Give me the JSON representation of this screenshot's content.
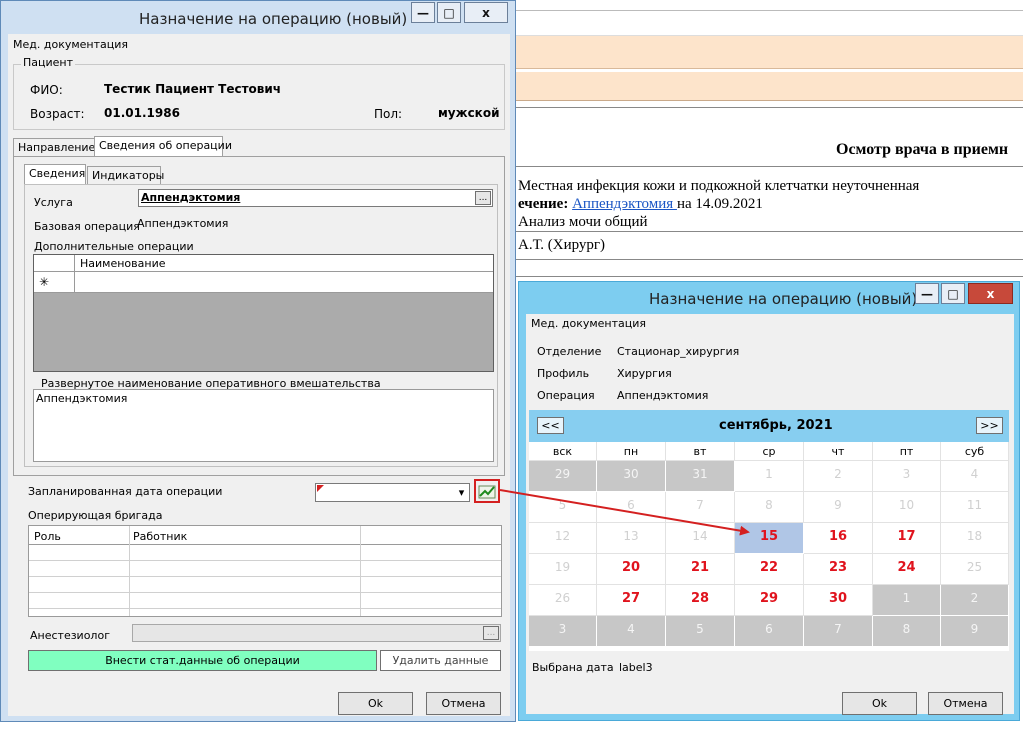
{
  "background_doc": {
    "heading": "Осмотр врача в приемн",
    "line1": "Местная инфекция кожи и подкожной клетчатки неуточненная",
    "line2_label": "ечение: ",
    "line2_link": "Аппендэктомия ",
    "line2_rest": "на 14.09.2021",
    "line3": "Анализ мочи общий",
    "line4": "А.Т. (Хирург)"
  },
  "main_window": {
    "title": "Назначение на операцию (новый)",
    "controls": {
      "minimize": "—",
      "maximize": "□",
      "close": "x"
    },
    "menu_label": "Мед. документация",
    "patient": {
      "group_label": "Пациент",
      "fio_label": "ФИО:",
      "fio_value": "Тестик Пациент Тестович",
      "age_label": "Возраст:",
      "age_value": "01.01.1986",
      "sex_label": "Пол:",
      "sex_value": "мужской"
    },
    "tabs": [
      "Направление",
      "Сведения об операции"
    ],
    "subtabs": [
      "Сведения",
      "Индикаторы"
    ],
    "service_label": "Услуга",
    "service_value": "Аппендэктомия",
    "browse_label": "...",
    "base_op_label": "Базовая операция",
    "base_op_value": "Аппендэктомия",
    "extra_ops_label": "Дополнительные операции",
    "extra_ops_column": "Наименование",
    "new_row_marker": "✳",
    "full_name_label": "Развернутое наименование оперативного вмешательства",
    "full_name_value": "Аппендэктомия",
    "planned_date_label": "Запланированная дата операции",
    "dropdown_arrow": "▾",
    "team_label": "Оперирующая бригада",
    "team_columns": [
      "Роль",
      "Работник"
    ],
    "anesthesiologist_label": "Анестезиолог",
    "stat_button": "Внести стат.данные об операции",
    "delete_button": "Удалить данные",
    "ok_button": "Ok",
    "cancel_button": "Отмена",
    "stat_button_color": "#80ffc0"
  },
  "calendar_window": {
    "title": "Назначение на операцию (новый)",
    "controls": {
      "minimize": "—",
      "maximize": "□",
      "close": "x"
    },
    "menu_label": "Мед. документация",
    "department_label": "Отделение",
    "department_value": "Стационар_хирургия",
    "profile_label": "Профиль",
    "profile_value": "Хирургия",
    "operation_label": "Операция",
    "operation_value": "Аппендэктомия",
    "prev_button": "<<",
    "next_button": ">>",
    "month_title": "сентябрь, 2021",
    "weekdays": [
      "вск",
      "пн",
      "вт",
      "ср",
      "чт",
      "пт",
      "суб"
    ],
    "weeks": [
      [
        {
          "d": "29",
          "s": "other"
        },
        {
          "d": "30",
          "s": "other"
        },
        {
          "d": "31",
          "s": "other"
        },
        {
          "d": "1",
          "s": "past"
        },
        {
          "d": "2",
          "s": "past"
        },
        {
          "d": "3",
          "s": "past"
        },
        {
          "d": "4",
          "s": "past"
        }
      ],
      [
        {
          "d": "5",
          "s": "past"
        },
        {
          "d": "6",
          "s": "past"
        },
        {
          "d": "7",
          "s": "past"
        },
        {
          "d": "8",
          "s": "past"
        },
        {
          "d": "9",
          "s": "past"
        },
        {
          "d": "10",
          "s": "past"
        },
        {
          "d": "11",
          "s": "past"
        }
      ],
      [
        {
          "d": "12",
          "s": "past"
        },
        {
          "d": "13",
          "s": "past"
        },
        {
          "d": "14",
          "s": "past"
        },
        {
          "d": "15",
          "s": "selected"
        },
        {
          "d": "16",
          "s": "active"
        },
        {
          "d": "17",
          "s": "active"
        },
        {
          "d": "18",
          "s": "past"
        }
      ],
      [
        {
          "d": "19",
          "s": "past"
        },
        {
          "d": "20",
          "s": "active"
        },
        {
          "d": "21",
          "s": "active"
        },
        {
          "d": "22",
          "s": "active"
        },
        {
          "d": "23",
          "s": "active"
        },
        {
          "d": "24",
          "s": "active"
        },
        {
          "d": "25",
          "s": "past"
        }
      ],
      [
        {
          "d": "26",
          "s": "past"
        },
        {
          "d": "27",
          "s": "active"
        },
        {
          "d": "28",
          "s": "active"
        },
        {
          "d": "29",
          "s": "active"
        },
        {
          "d": "30",
          "s": "active"
        },
        {
          "d": "1",
          "s": "other"
        },
        {
          "d": "2",
          "s": "other"
        }
      ],
      [
        {
          "d": "3",
          "s": "other"
        },
        {
          "d": "4",
          "s": "other"
        },
        {
          "d": "5",
          "s": "other"
        },
        {
          "d": "6",
          "s": "other"
        },
        {
          "d": "7",
          "s": "other"
        },
        {
          "d": "8",
          "s": "other"
        },
        {
          "d": "9",
          "s": "other"
        }
      ]
    ],
    "selected_label": "Выбрана дата",
    "selected_value": "label3",
    "ok_button": "Ok",
    "cancel_button": "Отмена"
  },
  "annotation": {
    "arrow_color": "#d42020"
  }
}
